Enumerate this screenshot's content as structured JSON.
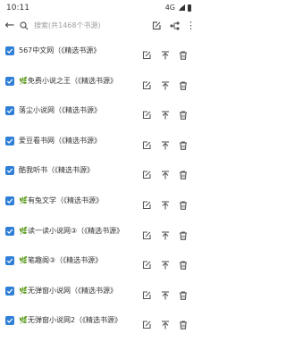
{
  "status_bar": {
    "time": "10:11",
    "network": "4G",
    "battery_percent": 71
  },
  "toolbar": {
    "back_icon": "arrow-back-icon",
    "search_placeholder": "搜索(共1468个书源)",
    "edit_icon": "edit-icon",
    "group_icon": "group-icon",
    "overflow_icon": "more-vert-icon"
  },
  "sources": [
    {
      "name": "567中文网（《精选书源》",
      "checked": true
    },
    {
      "name": "🌿免费小说之王（《精选书源》",
      "checked": true
    },
    {
      "name": "落尘小说网（《精选书源》",
      "checked": true
    },
    {
      "name": "爱豆看书网（《精选书源》",
      "checked": true
    },
    {
      "name": "酷我听书（《精选书源》",
      "checked": true
    },
    {
      "name": "🌿有兔文学（《精选书源》",
      "checked": true
    },
    {
      "name": "🌿读一读小说网③（《精选书源》",
      "checked": true
    },
    {
      "name": "🌿笔趣阁③（《精选书源》",
      "checked": true
    },
    {
      "name": "🌿无弹窗小说网（《精选书源》",
      "checked": true
    },
    {
      "name": "🌿无弹窗小说网2（《精选书源》",
      "checked": true
    }
  ],
  "row_actions": {
    "edit_icon": "edit-icon",
    "top_icon": "move-to-top-icon",
    "delete_icon": "delete-icon"
  },
  "colors": {
    "accent": "#2f7fd6",
    "icon": "#555555",
    "text": "#333333"
  }
}
